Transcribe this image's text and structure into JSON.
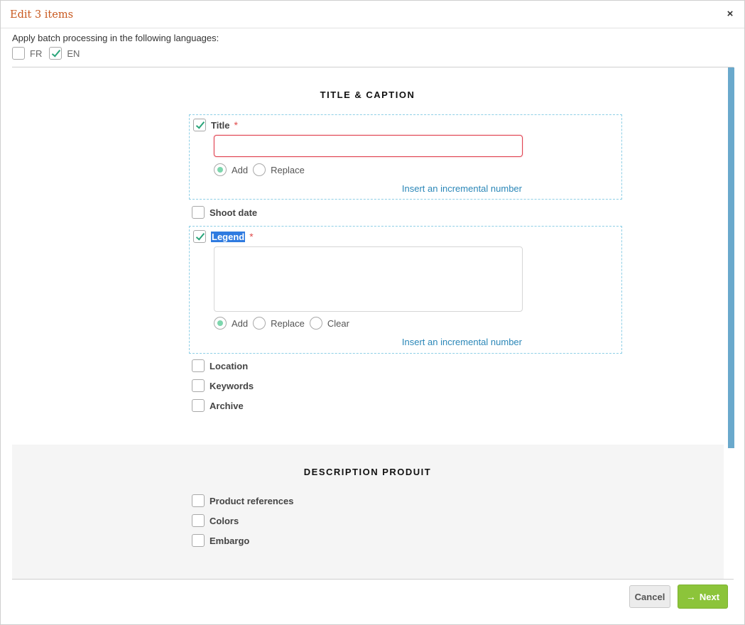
{
  "dialog": {
    "title": "Edit 3 items",
    "close_icon": "×"
  },
  "languages": {
    "label": "Apply batch processing in the following languages:",
    "options": [
      {
        "code": "FR",
        "checked": false
      },
      {
        "code": "EN",
        "checked": true
      }
    ]
  },
  "section1": {
    "title": "TITLE & CAPTION",
    "title_field": {
      "label": "Title",
      "required_mark": "*",
      "checked": true,
      "value": "",
      "radios": [
        {
          "label": "Add",
          "checked": true
        },
        {
          "label": "Replace",
          "checked": false
        }
      ],
      "link": "Insert an incremental number"
    },
    "shoot_date": {
      "label": "Shoot date",
      "checked": false
    },
    "legend_field": {
      "label": "Legend",
      "required_mark": "*",
      "checked": true,
      "value": "",
      "radios": [
        {
          "label": "Add",
          "checked": true
        },
        {
          "label": "Replace",
          "checked": false
        },
        {
          "label": "Clear",
          "checked": false
        }
      ],
      "link": "Insert an incremental number"
    },
    "others": [
      {
        "label": "Location",
        "checked": false
      },
      {
        "label": "Keywords",
        "checked": false
      },
      {
        "label": "Archive",
        "checked": false
      }
    ]
  },
  "section2": {
    "title": "DESCRIPTION PRODUIT",
    "items": [
      {
        "label": "Product references",
        "checked": false
      },
      {
        "label": "Colors",
        "checked": false
      },
      {
        "label": "Embargo",
        "checked": false
      }
    ]
  },
  "footer": {
    "cancel_label": "Cancel",
    "next_label": "Next",
    "next_icon": "→"
  },
  "colors": {
    "title": "#c8571c",
    "link": "#2b87b8",
    "next_button": "#8cc43a",
    "required": "#e04b4b",
    "scrollbar": "#6aa9cc"
  }
}
